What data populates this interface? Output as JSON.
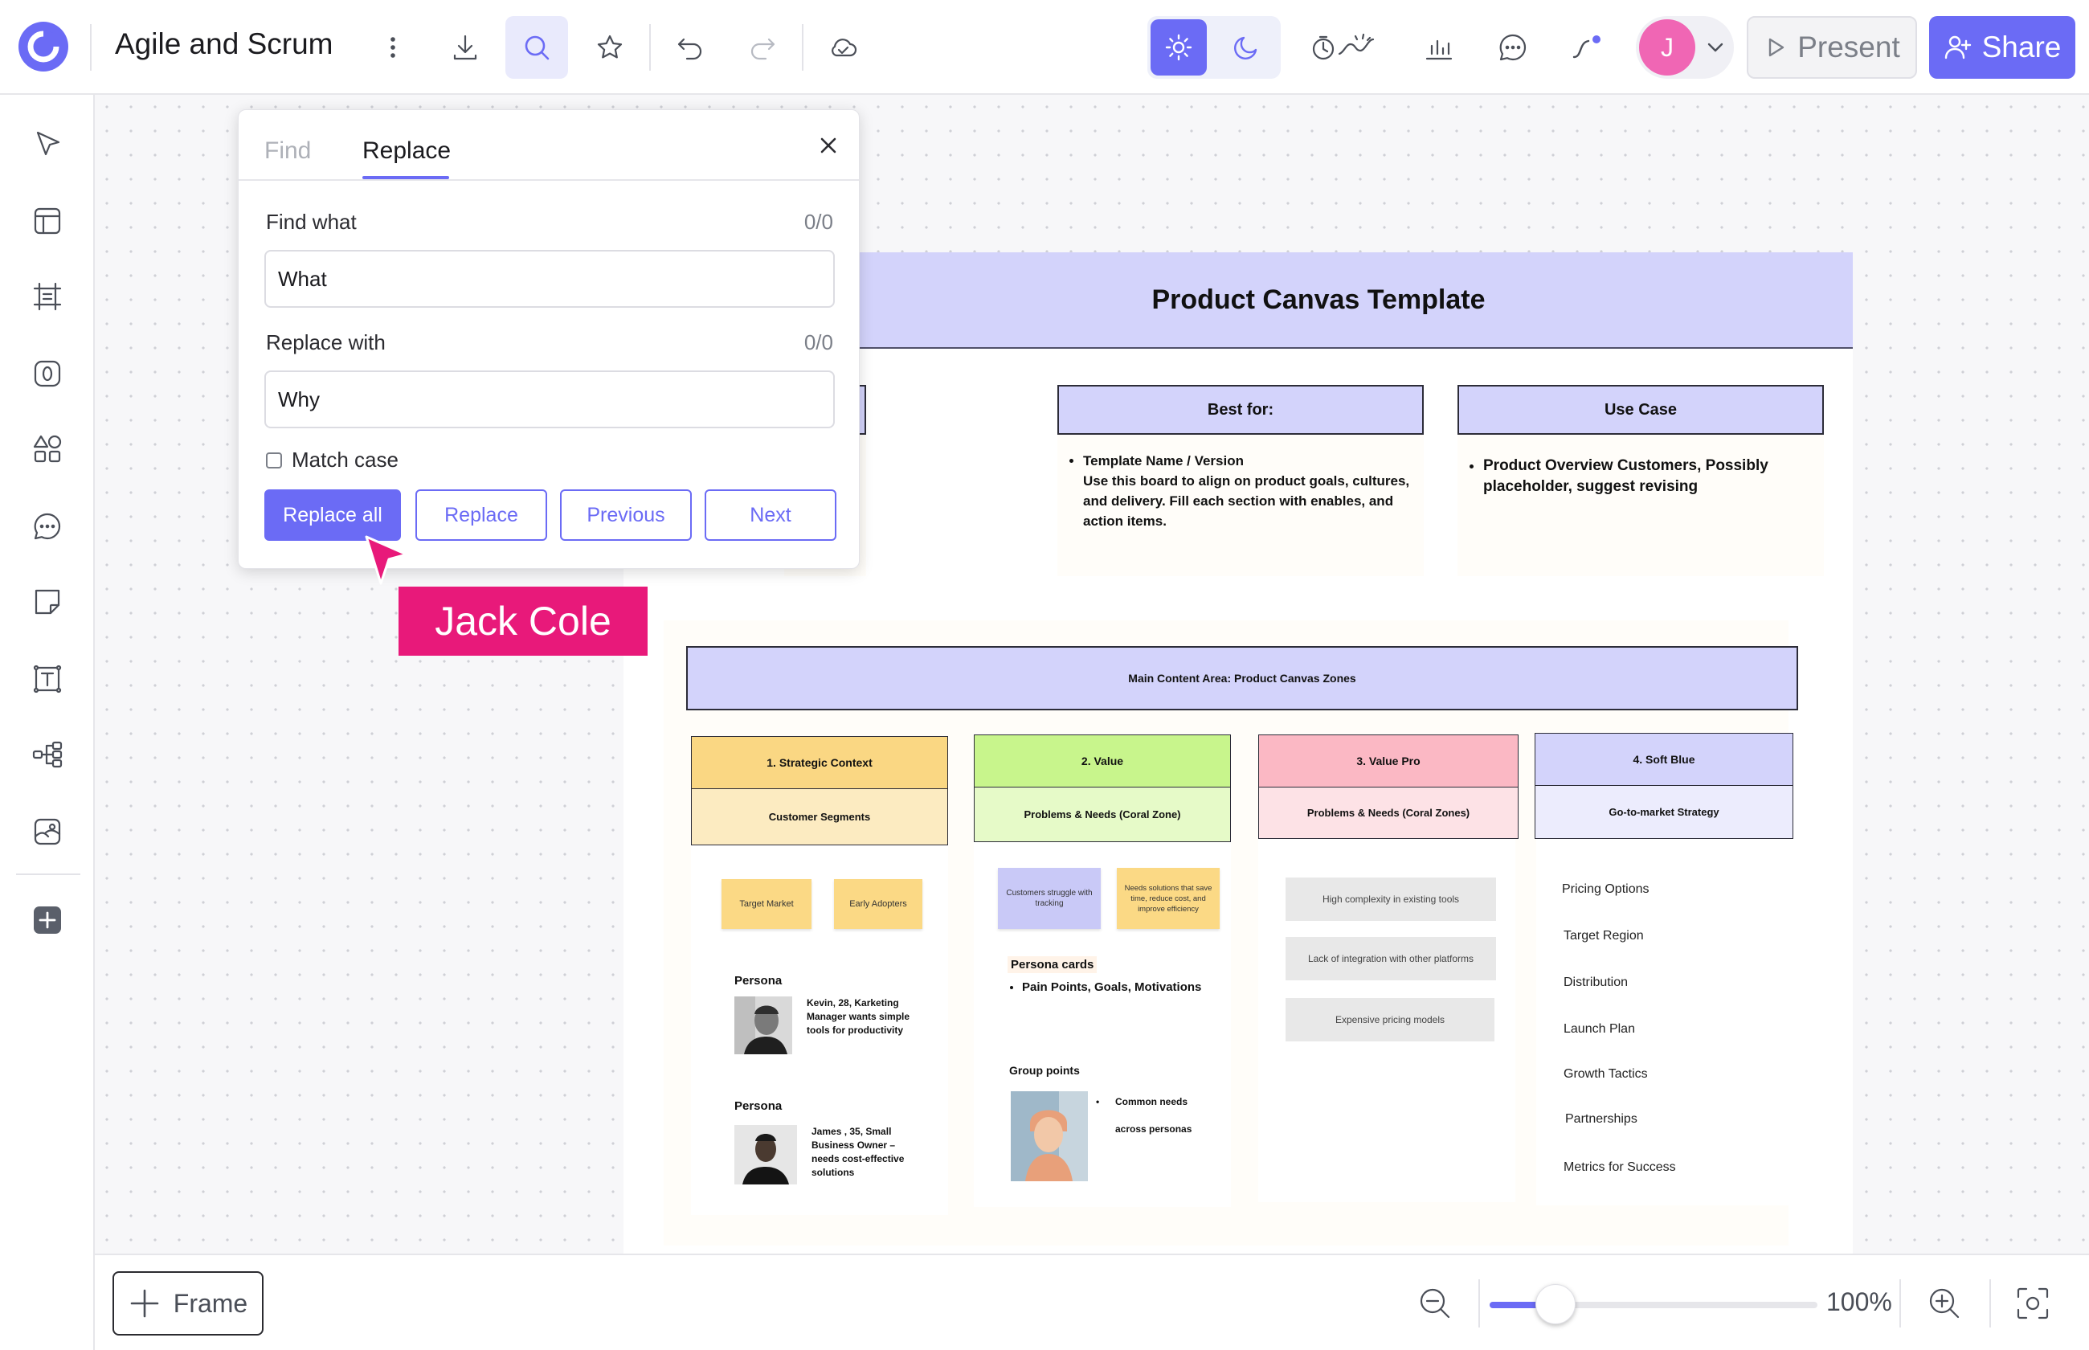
{
  "app": {
    "doc_title": "Agile and Scrum",
    "accent_color": "#6b6bf5",
    "user_initial": "J"
  },
  "toolbar": {
    "present_label": "Present",
    "share_label": "Share",
    "icons": [
      "logo-icon",
      "more-vertical-icon",
      "download-icon",
      "search-icon",
      "star-icon",
      "undo-icon",
      "redo-icon",
      "cloud-icon",
      "sun-icon",
      "moon-icon",
      "timer-icon",
      "chart-icon",
      "comment-icon",
      "connector-icon",
      "chevron-down-icon",
      "play-icon",
      "add-user-icon"
    ]
  },
  "sidebar": {
    "icons": [
      "select-icon",
      "template-icon",
      "frame-list-icon",
      "shape-icon",
      "shapes-icon",
      "comment-icon",
      "sticky-note-icon",
      "text-icon",
      "mindmap-icon",
      "image-icon",
      "plus-icon"
    ]
  },
  "find_replace": {
    "tab_find": "Find",
    "tab_replace": "Replace",
    "find_label": "Find what",
    "find_count": "0/0",
    "find_value": "What",
    "replace_label": "Replace with",
    "replace_count": "0/0",
    "replace_value": "Why",
    "match_case_label": "Match case",
    "match_case_checked": false,
    "buttons": {
      "replace_all": "Replace all",
      "replace": "Replace",
      "previous": "Previous",
      "next": "Next"
    }
  },
  "collaborator": {
    "name": "Jack Cole",
    "color": "#e8197a"
  },
  "board": {
    "title": "Product Canvas Template",
    "info": {
      "best_for": {
        "heading": "Best for:",
        "item_title": "Template Name / Version",
        "item_body": "Use this board to align on product goals, cultures, and delivery. Fill each section with enables, and action items."
      },
      "use_case": {
        "heading": "Use Case",
        "item": "Product Overview Customers, Possibly placeholder, suggest revising"
      }
    },
    "main_heading": "Main Content Area: Product Canvas Zones",
    "zones": [
      {
        "title": "1. Strategic Context",
        "subtitle": "Customer Segments",
        "title_color": "#fad783",
        "sub_color": "#fcebc1",
        "stickies": [
          "Target Market",
          "Early Adopters"
        ],
        "persona_label": "Persona",
        "persona_1": "Kevin, 28, Karketing Manager wants simple tools for productivity",
        "persona_label_2": "Persona",
        "persona_2": "James , 35, Small Business Owner – needs cost-effective solutions"
      },
      {
        "title": "2. Value",
        "subtitle": "Problems & Needs (Coral Zone)",
        "title_color": "#c8f58c",
        "sub_color": "#e6fac8",
        "stickies": [
          "Customers struggle with tracking",
          "Needs solutions that save time, reduce cost, and improve efficiency"
        ],
        "persona_cards_label": "Persona cards",
        "persona_cards_item": "Pain Points, Goals, Motivations",
        "group_label": "Group points",
        "group_line_1": "Common needs",
        "group_line_2": "across personas"
      },
      {
        "title": "3. Value Pro",
        "subtitle": "Problems & Needs (Coral Zones)",
        "title_color": "#fbb8c4",
        "sub_color": "#fde2e6",
        "cards": [
          "High complexity in existing tools",
          "Lack of integration with other platforms",
          "Expensive pricing models"
        ]
      },
      {
        "title": "4. Soft Blue",
        "subtitle": "Go-to-market Strategy",
        "title_color": "#d3d3fb",
        "sub_color": "#ececfd",
        "items": [
          "Pricing Options",
          "Target Region",
          "Distribution",
          "Launch Plan",
          "Growth Tactics",
          "Partnerships",
          "Metrics for Success"
        ]
      }
    ]
  },
  "bottom": {
    "frame_label": "Frame",
    "zoom_level": "100%",
    "zoom_slider_fraction": 0.2
  }
}
